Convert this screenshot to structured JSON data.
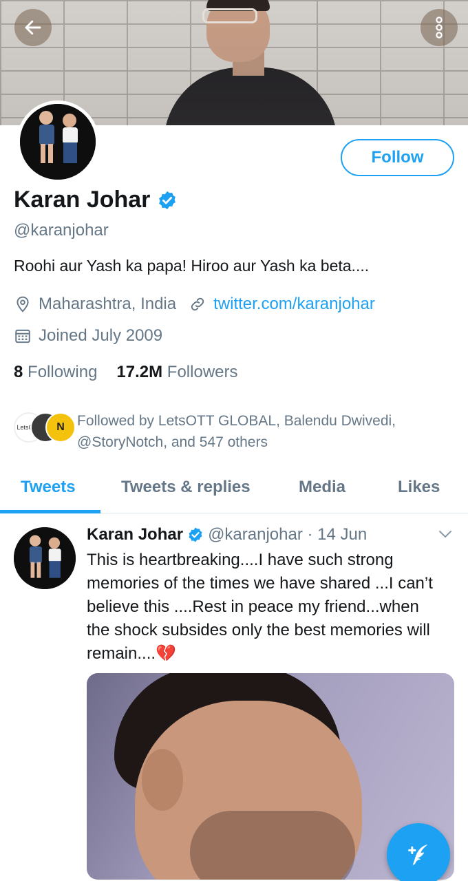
{
  "header": {
    "back_icon": "arrow-left-icon",
    "more_icon": "more-vertical-icon"
  },
  "profile": {
    "name": "Karan Johar",
    "verified": true,
    "handle": "@karanjohar",
    "bio": "Roohi aur Yash ka papa! Hiroo aur Yash ka beta....",
    "location": "Maharashtra, India",
    "website": "twitter.com/karanjohar",
    "joined": "Joined July 2009",
    "follow_label": "Follow",
    "following_count": "8",
    "following_label": "Following",
    "followers_count": "17.2M",
    "followers_label": "Followers",
    "followed_by_line1": "Followed by LetsOTT GLOBAL, Balendu Dwivedi,",
    "followed_by_line2": "@StoryNotch, and 547 others",
    "mini_avatar_lets": "LetsOTT",
    "mini_avatar_n": "N"
  },
  "tabs": [
    {
      "label": "Tweets",
      "active": true
    },
    {
      "label": "Tweets & replies",
      "active": false
    },
    {
      "label": "Media",
      "active": false
    },
    {
      "label": "Likes",
      "active": false
    }
  ],
  "tweet": {
    "author": "Karan Johar",
    "handle_date": "@karanjohar · 14 Jun",
    "text": "This is heartbreaking....I have such strong memories of the times we have shared ...I can’t believe this ....Rest in peace my friend...when the shock subsides only the best memories will remain....💔"
  },
  "colors": {
    "accent": "#1da1f2",
    "secondary_text": "#657786",
    "primary_text": "#14171a"
  },
  "fab_icon": "compose-tweet-icon"
}
